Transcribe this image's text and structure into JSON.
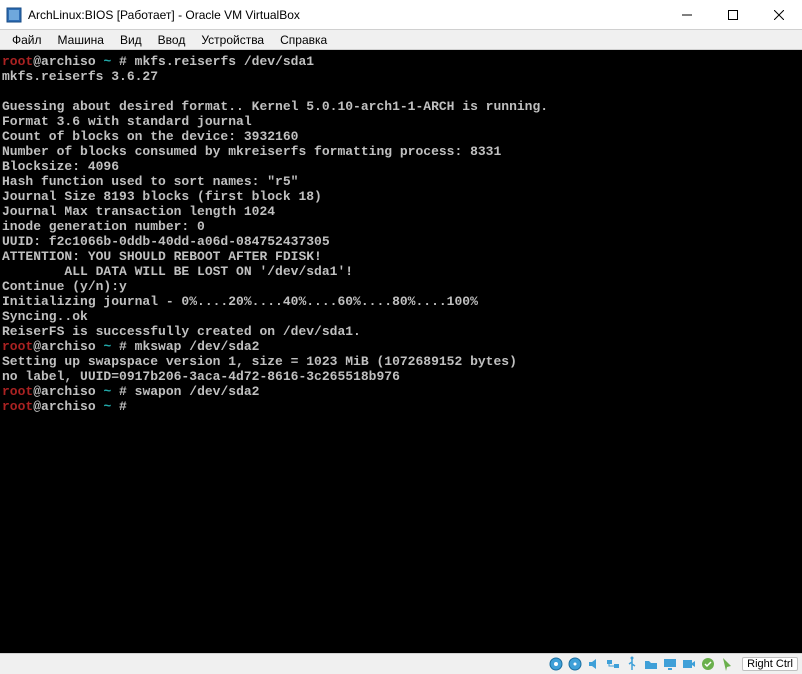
{
  "window": {
    "title": "ArchLinux:BIOS [Работает] - Oracle VM VirtualBox"
  },
  "menu": {
    "file": "Файл",
    "machine": "Машина",
    "view": "Вид",
    "input": "Ввод",
    "devices": "Устройства",
    "help": "Справка"
  },
  "terminal": {
    "lines": [
      {
        "t": "prompt",
        "user": "root",
        "host": "@archiso ",
        "path": "~",
        "sep": " # ",
        "cmd": "mkfs.reiserfs /dev/sda1"
      },
      {
        "t": "out",
        "text": "mkfs.reiserfs 3.6.27"
      },
      {
        "t": "out",
        "text": ""
      },
      {
        "t": "out",
        "text": "Guessing about desired format.. Kernel 5.0.10-arch1-1-ARCH is running."
      },
      {
        "t": "out",
        "text": "Format 3.6 with standard journal"
      },
      {
        "t": "out",
        "text": "Count of blocks on the device: 3932160"
      },
      {
        "t": "out",
        "text": "Number of blocks consumed by mkreiserfs formatting process: 8331"
      },
      {
        "t": "out",
        "text": "Blocksize: 4096"
      },
      {
        "t": "out",
        "text": "Hash function used to sort names: \"r5\""
      },
      {
        "t": "out",
        "text": "Journal Size 8193 blocks (first block 18)"
      },
      {
        "t": "out",
        "text": "Journal Max transaction length 1024"
      },
      {
        "t": "out",
        "text": "inode generation number: 0"
      },
      {
        "t": "out",
        "text": "UUID: f2c1066b-0ddb-40dd-a06d-084752437305"
      },
      {
        "t": "out",
        "text": "ATTENTION: YOU SHOULD REBOOT AFTER FDISK!"
      },
      {
        "t": "out",
        "text": "        ALL DATA WILL BE LOST ON '/dev/sda1'!"
      },
      {
        "t": "out",
        "text": "Continue (y/n):y"
      },
      {
        "t": "out",
        "text": "Initializing journal - 0%....20%....40%....60%....80%....100%"
      },
      {
        "t": "out",
        "text": "Syncing..ok"
      },
      {
        "t": "out",
        "text": "ReiserFS is successfully created on /dev/sda1."
      },
      {
        "t": "prompt",
        "user": "root",
        "host": "@archiso ",
        "path": "~",
        "sep": " # ",
        "cmd": "mkswap /dev/sda2"
      },
      {
        "t": "out",
        "text": "Setting up swapspace version 1, size = 1023 MiB (1072689152 bytes)"
      },
      {
        "t": "out",
        "text": "no label, UUID=0917b206-3aca-4d72-8616-3c265518b976"
      },
      {
        "t": "prompt",
        "user": "root",
        "host": "@archiso ",
        "path": "~",
        "sep": " # ",
        "cmd": "swapon /dev/sda2"
      },
      {
        "t": "prompt",
        "user": "root",
        "host": "@archiso ",
        "path": "~",
        "sep": " # ",
        "cmd": ""
      }
    ]
  },
  "status": {
    "host_key": "Right Ctrl"
  }
}
